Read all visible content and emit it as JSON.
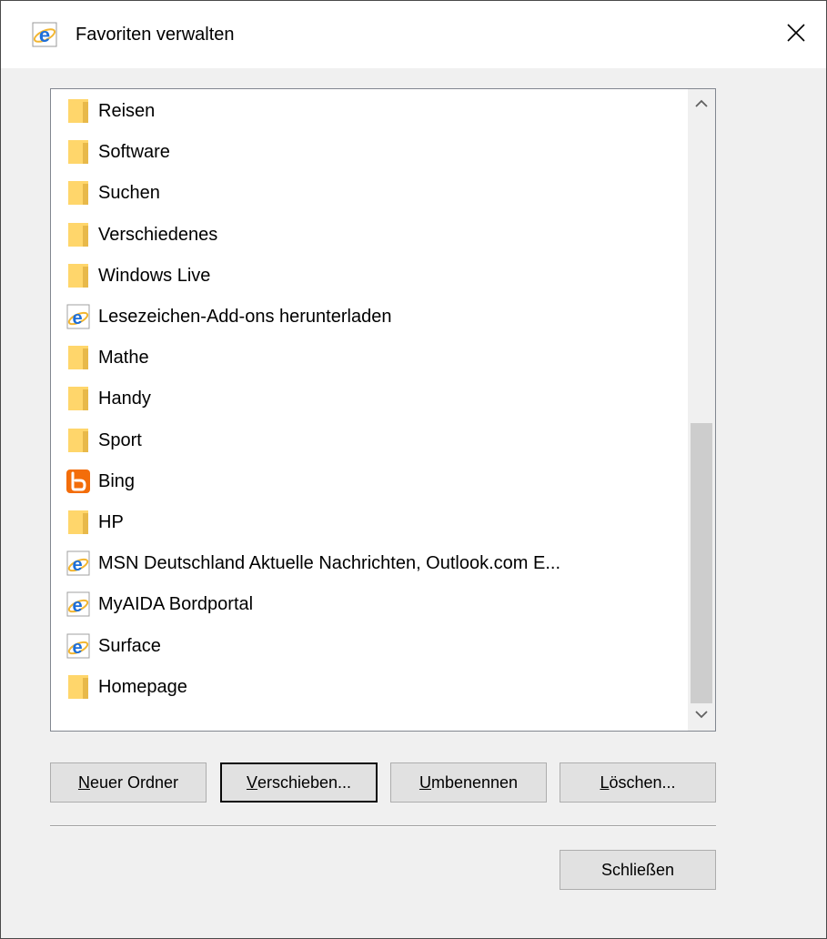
{
  "window": {
    "title": "Favoriten verwalten",
    "title_icon": "ie-icon",
    "close_glyph": "close-icon"
  },
  "favorites": [
    {
      "label": "Reisen",
      "icon": "folder-icon"
    },
    {
      "label": "Software",
      "icon": "folder-icon"
    },
    {
      "label": "Suchen",
      "icon": "folder-icon"
    },
    {
      "label": "Verschiedenes",
      "icon": "folder-icon"
    },
    {
      "label": "Windows Live",
      "icon": "folder-icon"
    },
    {
      "label": "Lesezeichen-Add-ons herunterladen",
      "icon": "ie-icon"
    },
    {
      "label": "Mathe",
      "icon": "folder-icon"
    },
    {
      "label": "Handy",
      "icon": "folder-icon"
    },
    {
      "label": "Sport",
      "icon": "folder-icon"
    },
    {
      "label": "Bing",
      "icon": "bing-icon"
    },
    {
      "label": "HP",
      "icon": "folder-icon"
    },
    {
      "label": "MSN Deutschland Aktuelle Nachrichten, Outlook.com E...",
      "icon": "ie-icon"
    },
    {
      "label": "MyAIDA Bordportal",
      "icon": "ie-icon"
    },
    {
      "label": "Surface",
      "icon": "ie-icon"
    },
    {
      "label": "Homepage",
      "icon": "folder-icon"
    }
  ],
  "buttons": {
    "new_folder": {
      "accel": "N",
      "rest": "euer Ordner"
    },
    "move": {
      "accel": "V",
      "rest": "erschieben..."
    },
    "rename": {
      "accel": "U",
      "rest": "mbenennen"
    },
    "delete": {
      "accel": "L",
      "rest": "öschen..."
    },
    "close": "Schließen"
  },
  "colors": {
    "folder": "#ffd66b",
    "ie_blue": "#1e6fd9",
    "bing_orange": "#f36d0a"
  }
}
